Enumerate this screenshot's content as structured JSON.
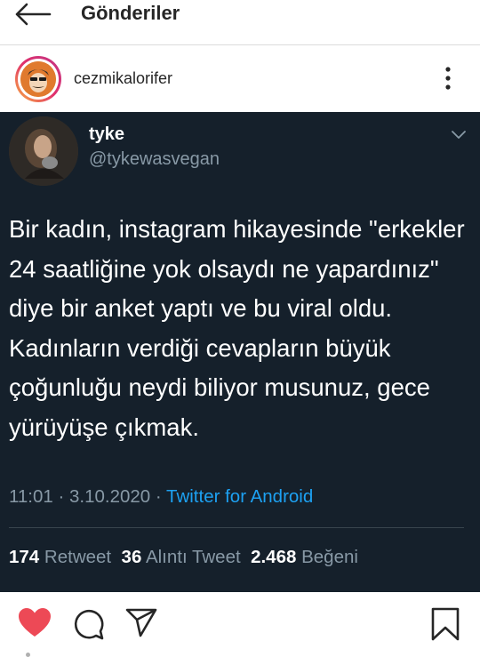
{
  "topbar": {
    "title": "Gönderiler"
  },
  "post": {
    "username": "cezmikalorifer"
  },
  "tweet": {
    "name": "tyke",
    "handle": "@tykewasvegan",
    "text": "Bir kadın, instagram hikayesinde \"erkekler 24 saatliğine yok olsaydı ne yapardınız\" diye bir anket yaptı ve bu viral oldu. Kadınların verdiği cevapların büyük çoğunluğu neydi biliyor musunuz, gece yürüyüşe çıkmak.",
    "time": "11:01 · 3.10.2020 · ",
    "source": "Twitter for Android",
    "retweets_count": "174",
    "retweets_label": "Retweet",
    "quotes_count": "36",
    "quotes_label": "Alıntı Tweet",
    "likes_count": "2.468",
    "likes_label": "Beğeni"
  },
  "colors": {
    "tweet_bg": "#15202b",
    "tweet_secondary": "#8899a6",
    "tweet_link": "#1da1f2",
    "like_red": "#ed4956"
  },
  "icons": {
    "back": "arrow-left-icon",
    "more": "more-vertical-icon",
    "caret": "chevron-down-icon",
    "like": "heart-icon",
    "comment": "comment-icon",
    "share": "send-icon",
    "save": "bookmark-icon"
  }
}
